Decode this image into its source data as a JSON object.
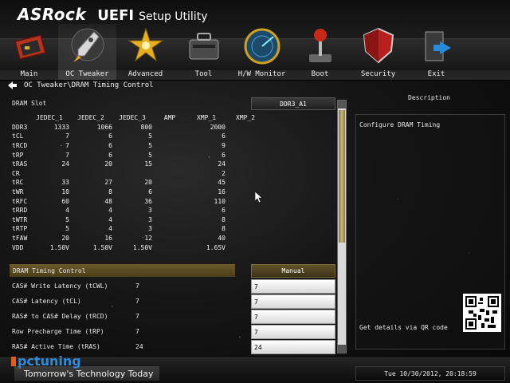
{
  "brand": {
    "logo": "ASRock",
    "product": "UEFI",
    "subtitle": "Setup Utility"
  },
  "menu": [
    {
      "label": "Main",
      "icon": "main-icon"
    },
    {
      "label": "OC Tweaker",
      "icon": "rocket-icon",
      "active": true
    },
    {
      "label": "Advanced",
      "icon": "star-icon"
    },
    {
      "label": "Tool",
      "icon": "toolbox-icon"
    },
    {
      "label": "H/W Monitor",
      "icon": "radar-icon"
    },
    {
      "label": "Boot",
      "icon": "joystick-icon"
    },
    {
      "label": "Security",
      "icon": "shield-icon"
    },
    {
      "label": "Exit",
      "icon": "exit-door-icon"
    }
  ],
  "breadcrumb": "OC Tweaker\\DRAM Timing Control",
  "dram_slot": {
    "label": "DRAM Slot",
    "value": "DDR3_A1"
  },
  "spd_table": {
    "headers": [
      "",
      "JEDEC_1",
      "JEDEC_2",
      "JEDEC_3",
      "AMP",
      "XMP_1",
      "XMP_2"
    ],
    "rows": [
      [
        "DDR3",
        "1333",
        "1066",
        "800",
        "",
        "2000",
        ""
      ],
      [
        "tCL",
        "7",
        "6",
        "5",
        "",
        "6",
        ""
      ],
      [
        "tRCD",
        "7",
        "6",
        "5",
        "",
        "9",
        ""
      ],
      [
        "tRP",
        "7",
        "6",
        "5",
        "",
        "6",
        ""
      ],
      [
        "tRAS",
        "24",
        "20",
        "15",
        "",
        "24",
        ""
      ],
      [
        "CR",
        "",
        "",
        "",
        "",
        "2",
        ""
      ],
      [
        "tRC",
        "33",
        "27",
        "20",
        "",
        "45",
        ""
      ],
      [
        "tWR",
        "10",
        "8",
        "6",
        "",
        "16",
        ""
      ],
      [
        "tRFC",
        "60",
        "48",
        "36",
        "",
        "110",
        ""
      ],
      [
        "tRRD",
        "4",
        "4",
        "3",
        "",
        "6",
        ""
      ],
      [
        "tWTR",
        "5",
        "4",
        "3",
        "",
        "8",
        ""
      ],
      [
        "tRTP",
        "5",
        "4",
        "3",
        "",
        "8",
        ""
      ],
      [
        "tFAW",
        "20",
        "16",
        "12",
        "",
        "40",
        ""
      ],
      [
        "VDD",
        "1.50V",
        "1.50V",
        "1.50V",
        "",
        "1.65V",
        ""
      ]
    ]
  },
  "timing_control": {
    "label": "DRAM Timing Control",
    "mode": "Manual"
  },
  "settings": [
    {
      "name": "CAS# Write Latency (tCWL)",
      "current": "7",
      "value": "7"
    },
    {
      "name": "CAS# Latency (tCL)",
      "current": "7",
      "value": "7"
    },
    {
      "name": "RAS# to CAS# Delay (tRCD)",
      "current": "7",
      "value": "7"
    },
    {
      "name": "Row Precharge Time (tRP)",
      "current": "7",
      "value": "7"
    },
    {
      "name": "RAS# Active Time (tRAS)",
      "current": "24",
      "value": "24"
    }
  ],
  "description": {
    "title": "Description",
    "text": "Configure DRAM Timing",
    "qr_hint": "Get details via QR code"
  },
  "footer": {
    "watermark": "pctuning",
    "tagline": "Tomorrow's Technology Today",
    "clock": "Tue 10/30/2012, 20:18:59"
  },
  "colors": {
    "accent_gold": "#6b5a2a",
    "field_bg": "#ffffff",
    "text": "#e8e8e8"
  }
}
